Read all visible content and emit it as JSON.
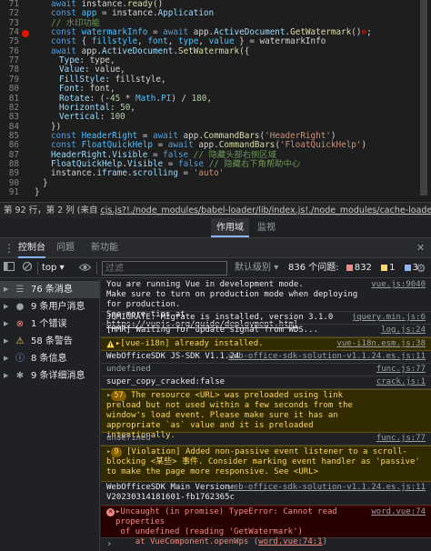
{
  "editor": {
    "lines": [
      {
        "n": "71",
        "indent": 2,
        "tokens": [
          [
            "kw",
            "await "
          ],
          [
            "p",
            "instance."
          ],
          [
            "fn",
            "ready"
          ],
          [
            "p",
            "()"
          ]
        ]
      },
      {
        "n": "72",
        "indent": 2,
        "tokens": [
          [
            "kw",
            "const "
          ],
          [
            "cn",
            "app"
          ],
          [
            "p",
            " = instance."
          ],
          [
            "vr",
            "Application"
          ]
        ]
      },
      {
        "n": "73",
        "indent": 2,
        "tokens": [
          [
            "cm",
            "// 水印功能"
          ]
        ]
      },
      {
        "n": "74",
        "indent": 2,
        "bp": true,
        "tokens": [
          [
            "kw",
            "const "
          ],
          [
            "cn",
            "watermarkInfo"
          ],
          [
            "p",
            " = "
          ],
          [
            "kw",
            "await "
          ],
          [
            "p",
            "app."
          ],
          [
            "vr",
            "ActiveDocument"
          ],
          [
            "p",
            "."
          ],
          [
            "fn",
            "GetWatermark"
          ],
          [
            "p",
            "()"
          ],
          [
            "red",
            "⊗"
          ],
          [
            "p",
            ";"
          ]
        ]
      },
      {
        "n": "75",
        "indent": 2,
        "tokens": [
          [
            "kw",
            "const "
          ],
          [
            "p",
            "{ "
          ],
          [
            "cn",
            "fillstyle"
          ],
          [
            "p",
            ", "
          ],
          [
            "cn",
            "font"
          ],
          [
            "p",
            ", "
          ],
          [
            "cn",
            "type"
          ],
          [
            "p",
            ", "
          ],
          [
            "cn",
            "value"
          ],
          [
            "p",
            " } = watermarkInfo"
          ]
        ]
      },
      {
        "n": "76",
        "indent": 2,
        "tokens": [
          [
            "kw",
            "await "
          ],
          [
            "p",
            "app."
          ],
          [
            "vr",
            "ActiveDocument"
          ],
          [
            "p",
            "."
          ],
          [
            "fn",
            "SetWatermark"
          ],
          [
            "p",
            "({"
          ]
        ]
      },
      {
        "n": "77",
        "indent": 3,
        "tokens": [
          [
            "vr",
            "Type"
          ],
          [
            "p",
            ": type,"
          ]
        ]
      },
      {
        "n": "78",
        "indent": 3,
        "tokens": [
          [
            "vr",
            "Value"
          ],
          [
            "p",
            ": value,"
          ]
        ]
      },
      {
        "n": "79",
        "indent": 3,
        "tokens": [
          [
            "vr",
            "FillStyle"
          ],
          [
            "p",
            ": fillstyle,"
          ]
        ]
      },
      {
        "n": "80",
        "indent": 3,
        "tokens": [
          [
            "vr",
            "Font"
          ],
          [
            "p",
            ": font,"
          ]
        ]
      },
      {
        "n": "81",
        "indent": 3,
        "tokens": [
          [
            "vr",
            "Rotate"
          ],
          [
            "p",
            ": (-"
          ],
          [
            "nm",
            "45"
          ],
          [
            "p",
            " * "
          ],
          [
            "cn",
            "Math"
          ],
          [
            "p",
            "."
          ],
          [
            "cn",
            "PI"
          ],
          [
            "p",
            ") / "
          ],
          [
            "nm",
            "180"
          ],
          [
            "p",
            ","
          ]
        ]
      },
      {
        "n": "82",
        "indent": 3,
        "tokens": [
          [
            "vr",
            "Horizontal"
          ],
          [
            "p",
            ": "
          ],
          [
            "nm",
            "50"
          ],
          [
            "p",
            ","
          ]
        ]
      },
      {
        "n": "83",
        "indent": 3,
        "tokens": [
          [
            "vr",
            "Vertical"
          ],
          [
            "p",
            ": "
          ],
          [
            "nm",
            "100"
          ]
        ]
      },
      {
        "n": "84",
        "indent": 2,
        "tokens": [
          [
            "p",
            "})"
          ]
        ]
      },
      {
        "n": "85",
        "indent": 2,
        "tokens": [
          [
            "kw",
            "const "
          ],
          [
            "cn",
            "HeaderRight"
          ],
          [
            "p",
            " = "
          ],
          [
            "kw",
            "await "
          ],
          [
            "p",
            "app."
          ],
          [
            "fn",
            "CommandBars"
          ],
          [
            "p",
            "("
          ],
          [
            "st",
            "'HeaderRight'"
          ],
          [
            "p",
            ")"
          ]
        ]
      },
      {
        "n": "86",
        "indent": 2,
        "tokens": [
          [
            "kw",
            "const "
          ],
          [
            "cn",
            "FloatQuickHelp"
          ],
          [
            "p",
            " = "
          ],
          [
            "kw",
            "await "
          ],
          [
            "p",
            "app."
          ],
          [
            "fn",
            "CommandBars"
          ],
          [
            "p",
            "("
          ],
          [
            "st",
            "'FloatQuickHelp'"
          ],
          [
            "p",
            ")"
          ]
        ]
      },
      {
        "n": "87",
        "indent": 2,
        "tokens": [
          [
            "vr",
            "HeaderRight"
          ],
          [
            "p",
            "."
          ],
          [
            "vr",
            "Visible"
          ],
          [
            "p",
            " = "
          ],
          [
            "kw",
            "false"
          ],
          [
            "p",
            " "
          ],
          [
            "cm",
            "// 隐藏头部右侧区域"
          ]
        ]
      },
      {
        "n": "88",
        "indent": 2,
        "tokens": [
          [
            "vr",
            "FloatQuickHelp"
          ],
          [
            "p",
            "."
          ],
          [
            "vr",
            "Visible"
          ],
          [
            "p",
            " = "
          ],
          [
            "kw",
            "false"
          ],
          [
            "p",
            " "
          ],
          [
            "cm",
            "// 隐藏右下角帮助中心"
          ]
        ]
      },
      {
        "n": "89",
        "indent": 2,
        "tokens": [
          [
            "p",
            "instance."
          ],
          [
            "vr",
            "iframe"
          ],
          [
            "p",
            "."
          ],
          [
            "vr",
            "scrolling"
          ],
          [
            "p",
            " = "
          ],
          [
            "st",
            "'auto'"
          ]
        ]
      },
      {
        "n": "90",
        "indent": 1,
        "tokens": [
          [
            "p",
            "}"
          ]
        ]
      },
      {
        "n": "91",
        "indent": 0,
        "tokens": [
          [
            "p",
            "}"
          ]
        ]
      }
    ]
  },
  "statusbar": {
    "position": "第 92 行，第 2 列",
    "source_prefix": "(来自 ",
    "source_link": "cjs.js?!./node_modules/babel-loader/lib/index.js!./node_modules/cache-loader/dist/cjs.js?!./"
  },
  "drawer": {
    "tabs": [
      {
        "label": "作用域",
        "active": true
      },
      {
        "label": "监视",
        "active": false
      }
    ]
  },
  "devtools": {
    "tabs": [
      {
        "label": "控制台",
        "active": true
      },
      {
        "label": "问题",
        "active": false
      },
      {
        "label": "新功能",
        "active": false
      }
    ],
    "context": "top",
    "filter_placeholder": "过滤",
    "level": "默认级别",
    "issues_label": "836 个问题:",
    "issue_counts": {
      "error": "832",
      "warn": "1",
      "info": "3"
    },
    "colors": {
      "error": "#f28b82",
      "warn": "#fdd663",
      "info": "#8ab4f8"
    }
  },
  "sidebar": [
    {
      "label": "76 条消息",
      "icon": "list-icon",
      "glyph": "☰",
      "color": "#9aa0a6",
      "active": true
    },
    {
      "label": "9 条用户消息",
      "icon": "user-icon",
      "glyph": "●",
      "color": "#9aa0a6",
      "active": false
    },
    {
      "label": "1 个错误",
      "icon": "error-icon",
      "glyph": "⊗",
      "color": "#f28b82",
      "active": false
    },
    {
      "label": "58 条警告",
      "icon": "warning-icon",
      "glyph": "⚠",
      "color": "#fdd663",
      "active": false
    },
    {
      "label": "8 条信息",
      "icon": "info-icon",
      "glyph": "ⓘ",
      "color": "#8ab4f8",
      "active": false
    },
    {
      "label": "9 条详细消息",
      "icon": "verbose-icon",
      "glyph": "✱",
      "color": "#9aa0a6",
      "active": false
    }
  ],
  "console": {
    "m1_text": "You are running Vue in development mode.\nMake sure to turn on production mode when deploying for production.\nSee more tips at ",
    "m1_link": "https://vuejs.org/guide/deployment.html",
    "m1_src": "vue.js:9040",
    "m2_text": "JQMIGRATE: Migrate is installed, version 3.1.0",
    "m2_src": "jquery.min.js:6",
    "m3_text": "[HMR] Waiting for update signal from WDS...",
    "m3_src": "log.js:24",
    "m4_text": "▸[vue-i18n] already installed.",
    "m4_src": "vue-i18n.esm.js:38",
    "m5_text": "WebOfficeSDK JS-SDK V1.1.24",
    "m5_src": "web-office-sdk-solution-v1.1.24.es.js:11",
    "m6_text": "undefined",
    "m6_src": "func.js:77",
    "m7_text": "super_copy_cracked:false",
    "m7_src": "crack.js:1",
    "m8_badge": "57",
    "m8_text": "The resource <URL> was preloaded using link preload but not used within a few seconds from the window's load event. Please make sure it has an appropriate `as` value and it is preloaded intentionally.",
    "m9_text": "undefined",
    "m9_src": "func.js:77",
    "m10_badge": "9",
    "m10_text": "[Violation] Added non-passive event listener to a scroll-blocking <某些> 事件. Consider marking event handler as 'passive' to make the page more responsive. See <URL>",
    "m11_text": "WebOfficeSDK Main Version:\nV20230314181601-fb1762365c",
    "m11_src": "web-office-sdk-solution-v1.1.24.es.js:11",
    "m12_text": "▸Uncaught (in promise) TypeError: Cannot read properties\n of undefined (reading 'GetWatermark')\n    at VueComponent.openWps (",
    "m12_link": "word.vue:74:1",
    "m12_tail": ")",
    "m12_src": "word.vue:74",
    "prompt": "›"
  }
}
